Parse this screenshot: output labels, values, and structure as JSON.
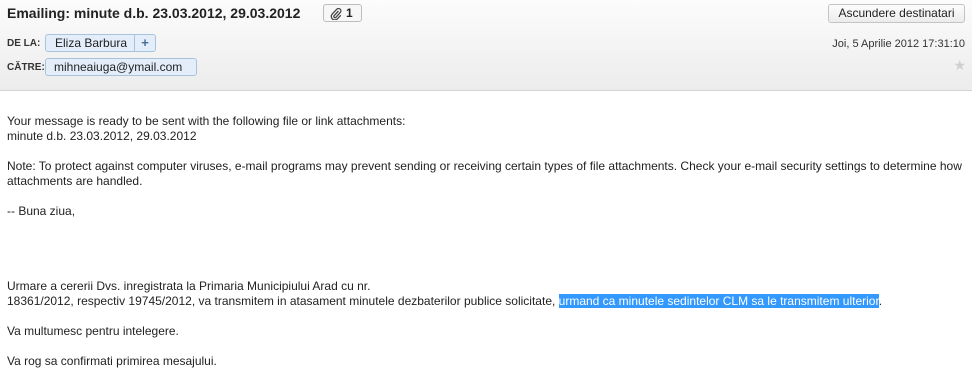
{
  "header": {
    "subject": "Emailing: minute d.b. 23.03.2012, 29.03.2012",
    "attachment_count": "1",
    "hide_recipients_label": "Ascundere destinatari",
    "from_label": "DE LA:",
    "from_name": "Eliza Barbura",
    "add_contact_symbol": "+",
    "to_label": "CĂTRE:",
    "to_address": "mihneaiuga@ymail.com",
    "date": "Joi, 5 Aprilie 2012 17:31:10"
  },
  "body": {
    "line1": "Your message is ready to be sent with the following file or link attachments:",
    "line2": "minute d.b. 23.03.2012, 29.03.2012",
    "note": "Note: To protect against computer viruses, e-mail programs may prevent sending or receiving certain types of file attachments.  Check your e-mail security settings to determine how attachments are handled.",
    "greeting": "-- Buna ziua,",
    "para1_line1": "Urmare a cererii Dvs. inregistrata la Primaria Municipiului Arad cu nr.",
    "para1_line2_start": "18361/2012, respectiv 19745/2012, va transmitem in atasament minutele dezbaterilor publice solicitate, ",
    "para1_line2_selected": "urmand ca minutele sedintelor CLM sa le transmitem ulterior",
    "para1_line2_end": ".",
    "thanks": "Va multumesc pentru intelegere.",
    "confirm": "Va rog sa confirmati primirea mesajului."
  },
  "colors": {
    "selection": "#3399ff",
    "chip_bg": "#e3eefa",
    "chip_border": "#a9c3dd"
  }
}
